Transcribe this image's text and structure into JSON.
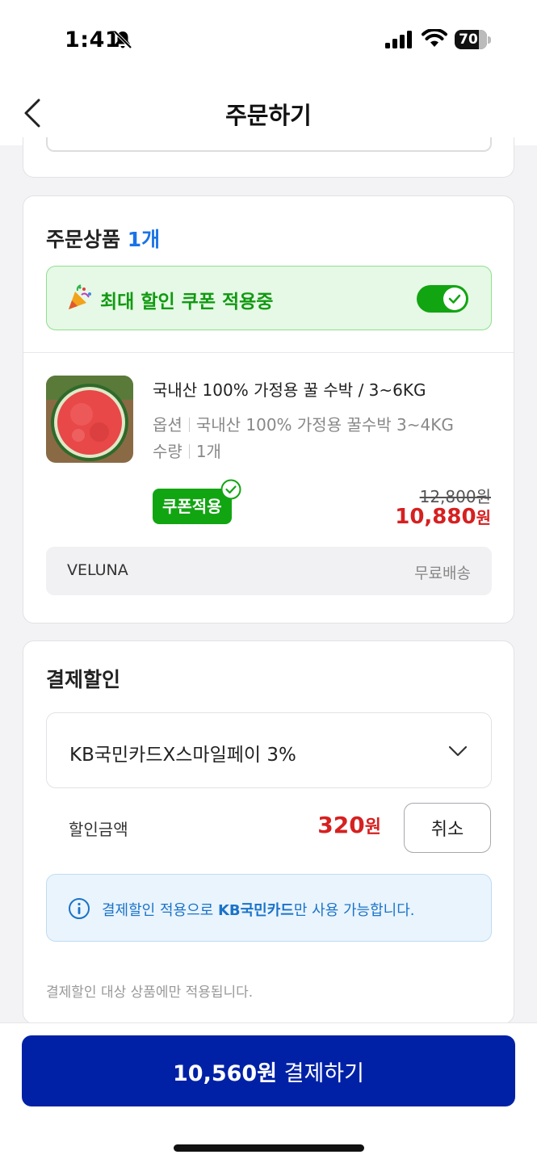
{
  "status_bar": {
    "time": "1:41",
    "battery": "70",
    "icons": [
      "bell-off-icon",
      "signal-icon",
      "wifi-icon",
      "battery-icon"
    ]
  },
  "header": {
    "title": "주문하기",
    "back_icon": "chevron-left-icon"
  },
  "products_section": {
    "title": "주문상품",
    "count": "1개",
    "coupon_banner": {
      "emoji": "🎉",
      "text": "최대 할인 쿠폰 적용중",
      "toggle_on": true
    },
    "items": [
      {
        "name": "국내산 100% 가정용 꿀 수박 / 3~6KG",
        "option_label": "옵션",
        "option_value": "국내산 100% 가정용 꿀수박 3~4KG",
        "quantity_label": "수량",
        "quantity_value": "1개",
        "coupon_badge": "쿠폰적용",
        "original_price": "12,800",
        "original_price_unit": "원",
        "sale_price": "10,880",
        "sale_price_unit": "원"
      }
    ],
    "seller": {
      "name": "VELUNA",
      "shipping": "무료배송"
    }
  },
  "payment_discount": {
    "title": "결제할인",
    "selected_card": "KB국민카드X스마일페이 3%",
    "amount_label": "할인금액",
    "amount_value": "320",
    "amount_unit": "원",
    "cancel_label": "취소",
    "info": {
      "prefix": "결제할인 적용으로 ",
      "highlight": "KB국민카드",
      "suffix": "만 사용 가능합니다."
    },
    "note": "결제할인 대상 상품에만 적용됩니다."
  },
  "checkout": {
    "amount": "10,560원",
    "label": "결제하기"
  },
  "colors": {
    "accent_blue": "#1a73e8",
    "coupon_green": "#12a512",
    "sale_red": "#d62020",
    "pay_button": "#0021a6"
  }
}
